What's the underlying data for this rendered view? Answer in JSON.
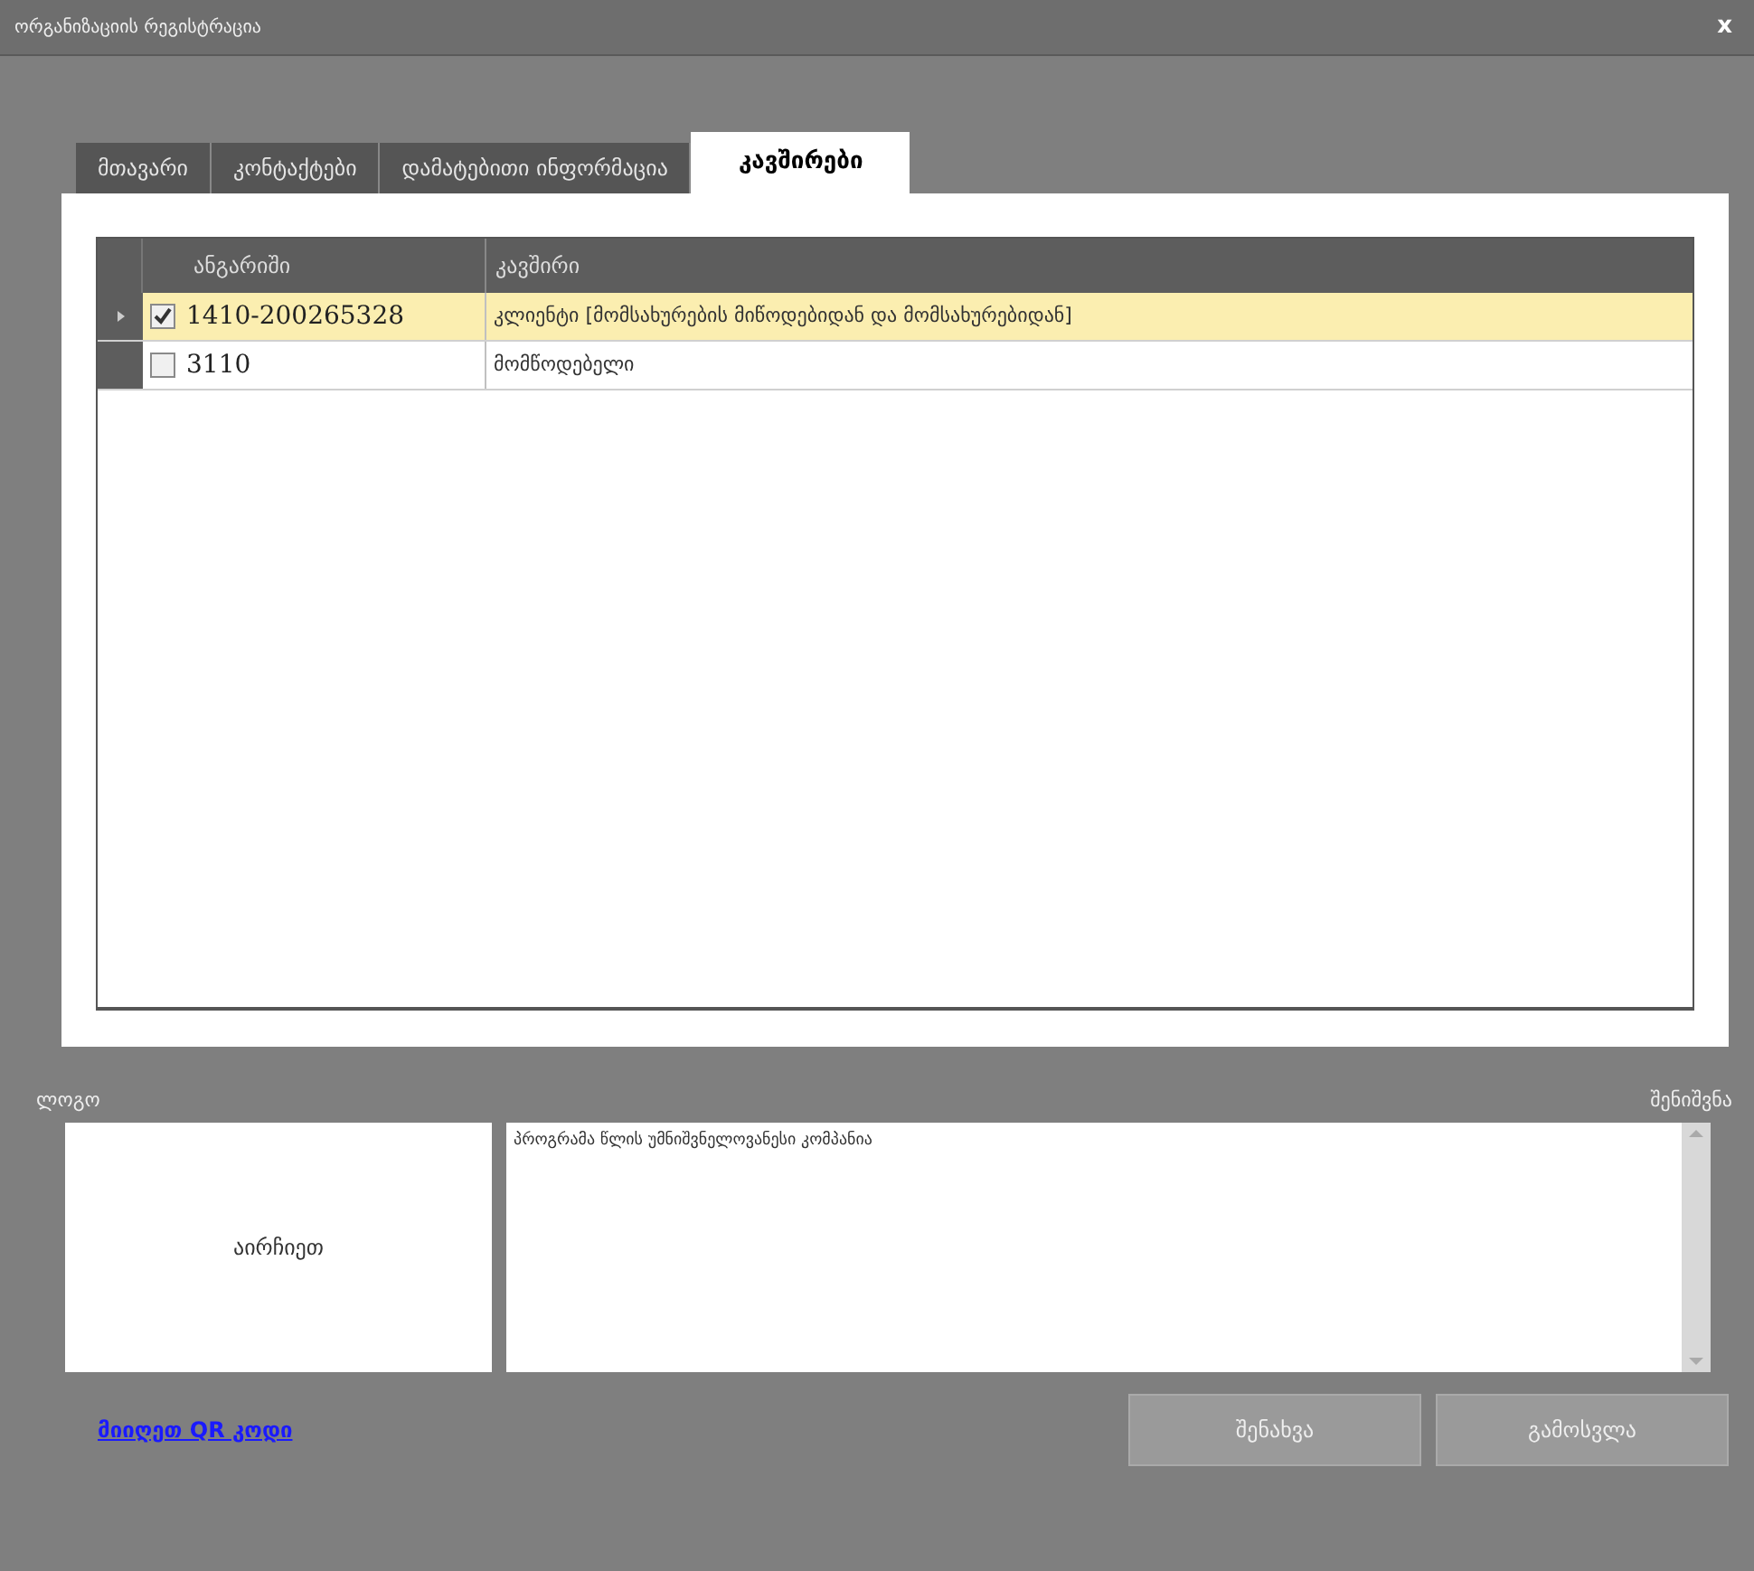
{
  "window": {
    "title": "ორგანიზაციის რეგისტრაცია",
    "close": "x"
  },
  "tabs": [
    {
      "label": "მთავარი",
      "selected": false
    },
    {
      "label": "კონტაქტები",
      "selected": false
    },
    {
      "label": "დამატებითი ინფორმაცია",
      "selected": false
    },
    {
      "label": "კავშირები",
      "selected": true
    }
  ],
  "table": {
    "columns": [
      "ანგარიში",
      "კავშირი"
    ],
    "rows": [
      {
        "account": "1410-200265328",
        "relation": "კლიენტი [მომსახურების მიწოდებიდან და მომსახურებიდან]",
        "checked": true,
        "selected": true
      },
      {
        "account": "3110",
        "relation": "მომწოდებელი",
        "checked": false,
        "selected": false
      }
    ]
  },
  "logo": {
    "label": "ლოგო",
    "placeholder": "აირჩიეთ"
  },
  "notes": {
    "label": "შენიშვნა",
    "value": "პროგრამა წლის უმნიშვნელოვანესი კომპანია"
  },
  "qr_link": "მიიღეთ QR კოდი",
  "buttons": [
    "შენახვა",
    "გამოსვლა"
  ]
}
